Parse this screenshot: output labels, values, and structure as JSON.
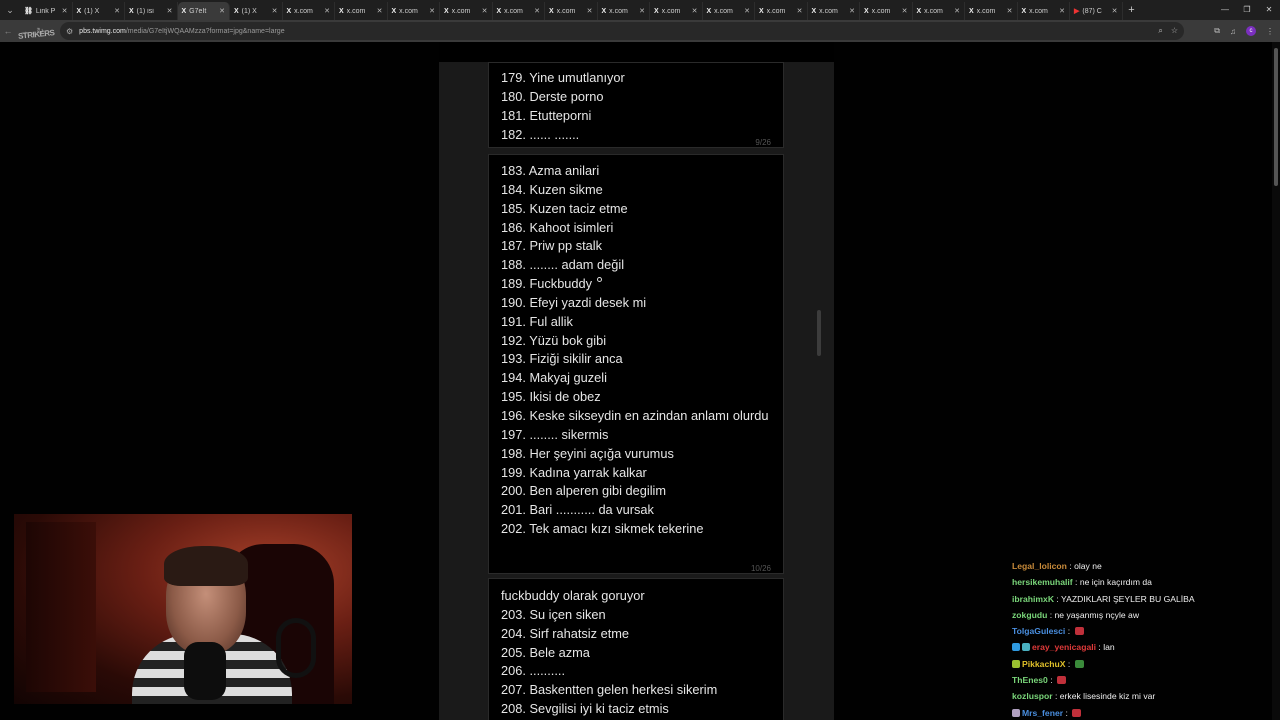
{
  "browser": {
    "tabs": [
      {
        "favicon": "link-icon",
        "title": "Link P",
        "active": false,
        "fav_glyph": "⛓"
      },
      {
        "favicon": "x-logo-icon",
        "title": "(1) X",
        "active": false,
        "fav_glyph": "X"
      },
      {
        "favicon": "x-logo-icon",
        "title": "(1) isi",
        "active": false,
        "fav_glyph": "X"
      },
      {
        "favicon": "x-logo-icon",
        "title": "G7eIt",
        "active": true,
        "fav_glyph": "X"
      },
      {
        "favicon": "x-logo-icon",
        "title": "(1) X",
        "active": false,
        "fav_glyph": "X"
      },
      {
        "favicon": "x-logo-icon",
        "title": "x.com",
        "active": false,
        "fav_glyph": "X"
      },
      {
        "favicon": "x-logo-icon",
        "title": "x.com",
        "active": false,
        "fav_glyph": "X"
      },
      {
        "favicon": "x-logo-icon",
        "title": "x.com",
        "active": false,
        "fav_glyph": "X"
      },
      {
        "favicon": "x-logo-icon",
        "title": "x.com",
        "active": false,
        "fav_glyph": "X"
      },
      {
        "favicon": "x-logo-icon",
        "title": "x.com",
        "active": false,
        "fav_glyph": "X"
      },
      {
        "favicon": "x-logo-icon",
        "title": "x.com",
        "active": false,
        "fav_glyph": "X"
      },
      {
        "favicon": "x-logo-icon",
        "title": "x.com",
        "active": false,
        "fav_glyph": "X"
      },
      {
        "favicon": "x-logo-icon",
        "title": "x.com",
        "active": false,
        "fav_glyph": "X"
      },
      {
        "favicon": "x-logo-icon",
        "title": "x.com",
        "active": false,
        "fav_glyph": "X"
      },
      {
        "favicon": "x-logo-icon",
        "title": "x.com",
        "active": false,
        "fav_glyph": "X"
      },
      {
        "favicon": "x-logo-icon",
        "title": "x.com",
        "active": false,
        "fav_glyph": "X"
      },
      {
        "favicon": "x-logo-icon",
        "title": "x.com",
        "active": false,
        "fav_glyph": "X"
      },
      {
        "favicon": "x-logo-icon",
        "title": "x.com",
        "active": false,
        "fav_glyph": "X"
      },
      {
        "favicon": "x-logo-icon",
        "title": "x.com",
        "active": false,
        "fav_glyph": "X"
      },
      {
        "favicon": "x-logo-icon",
        "title": "x.com",
        "active": false,
        "fav_glyph": "X"
      },
      {
        "favicon": "youtube-icon",
        "title": "(87) C",
        "active": false,
        "fav_glyph": "▶"
      }
    ],
    "new_tab": "+",
    "url_host": "pbs.twimg.com",
    "url_path": "/media/G7eItjWQAAMzza?format=jpg&name=large",
    "overlay_logo": "STRIKERS"
  },
  "document": {
    "card1": {
      "lines": [
        "179. Yine umutlanıyor",
        "180. Derste porno",
        "181. Etutteporni",
        "182. ......  ......."
      ],
      "page": "9/26"
    },
    "card2": {
      "lines": [
        "183. Azma anilari",
        "184. Kuzen sikme",
        "185. Kuzen taciz etme",
        "186. Kahoot isimleri",
        "187. Priw pp stalk",
        "188. ........  adam değil",
        "189. Fuckbuddy",
        "190. Efeyi yazdi desek mi",
        "191. Ful allik",
        "192. Yüzü bok gibi",
        "193. Fiziği sikilir anca",
        "194. Makyaj guzeli",
        "195. Ikisi de obez",
        "196. Keske sikseydin en azindan anlamı olurdu",
        "197. ........ sikermis",
        "198. Her şeyini açığa vurumus",
        "199. Kadına yarrak kalkar",
        "200. Ben alperen gibi degilim",
        "201. Bari ........... da vursak",
        "202. Tek amacı kızı sikmek tekerine"
      ],
      "page": "10/26"
    },
    "card3": {
      "lines": [
        "fuckbuddy olarak goruyor",
        "203. Su içen siken",
        "204. Sirf rahatsiz etme",
        "205. Bele azma",
        "206. ..........",
        "207. Baskentten gelen herkesi sikerim",
        "208. Sevgilisi iyi ki taciz etmis"
      ]
    }
  },
  "chat": {
    "messages": [
      {
        "user": "Legal_lolicon",
        "color": "#c98b3a",
        "text": "olay ne",
        "badges": [],
        "emote": null
      },
      {
        "user": "hersikemuhalif",
        "color": "#7ad67a",
        "text": "ne için kaçırdım da",
        "badges": [],
        "emote": null
      },
      {
        "user": "ibrahimxK",
        "color": "#7ad67a",
        "text": "YAZDIKLARI ŞEYLER BU GALİBA",
        "badges": [],
        "emote": null
      },
      {
        "user": "zokgudu",
        "color": "#7ad67a",
        "text": "ne yaşanmış nçyle aw",
        "badges": [],
        "emote": null
      },
      {
        "user": "TolgaGulesci",
        "color": "#4a8fe0",
        "text": "",
        "badges": [],
        "emote": "#c0303a"
      },
      {
        "user": "eray_yenicagali",
        "color": "#e03a3a",
        "text": "lan",
        "badges": [
          "#2f9ae0",
          "#4ab0c0"
        ],
        "emote": null
      },
      {
        "user": "PikkachuX",
        "color": "#e0c02a",
        "text": "",
        "badges": [
          "#9ac030"
        ],
        "emote": "#3a8a3a"
      },
      {
        "user": "ThEnes0",
        "color": "#7ad67a",
        "text": "",
        "badges": [],
        "emote": "#c0303a"
      },
      {
        "user": "kozluspor",
        "color": "#7ad67a",
        "text": "erkek lisesinde kiz mi var",
        "badges": [],
        "emote": null
      },
      {
        "user": "Mrs_fener",
        "color": "#4a8fe0",
        "text": "",
        "badges": [
          "#b0a0c0"
        ],
        "emote": "#c0303a"
      }
    ]
  }
}
